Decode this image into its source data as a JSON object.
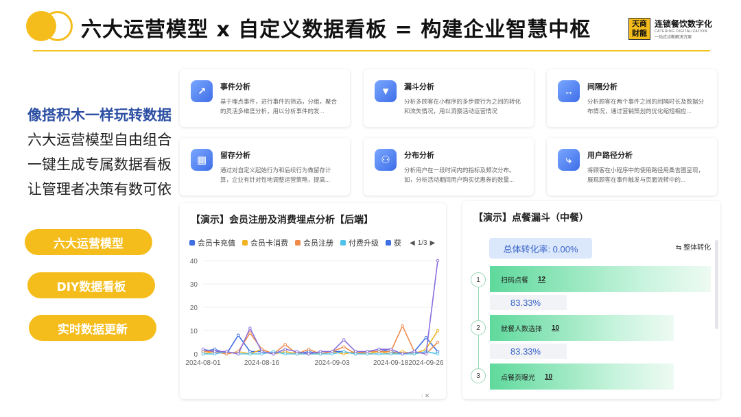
{
  "header": {
    "title": "六大运营模型 x 自定义数据看板 = 构建企业智慧中枢",
    "brand": {
      "seal_top": "天商",
      "seal_bottom": "财龍",
      "name": "连锁餐饮数字化",
      "sub": "CATERING DIGITALIZATION",
      "slogan": "一站式诊断解决方案"
    },
    "accent_color": "#f5bd1c"
  },
  "slogans": [
    "像搭积木一样玩转数据",
    "六大运营模型自由组合",
    "一键生成专属数据看板",
    "让管理者决策有数可依"
  ],
  "pills": [
    "六大运营模型",
    "DIY数据看板",
    "实时数据更新"
  ],
  "cards": [
    {
      "title": "事件分析",
      "icon": "chart-line-icon",
      "desc": "基于埋点事件，进行事件的筛选，分组，聚合的灵活多维度分析，用以分析事件的发..."
    },
    {
      "title": "漏斗分析",
      "icon": "funnel-icon",
      "desc": "分析多顾客在小程序的多步骤行为之间的转化和流失情况，用以洞察活动运营情况"
    },
    {
      "title": "间隔分析",
      "icon": "interval-icon",
      "desc": "分析顾客在两个事件之间的间隔时长及数据分布情况，通过营销策划的优化缩短相应..."
    },
    {
      "title": "留存分析",
      "icon": "table-icon",
      "desc": "通过对自定义起始行为和后续行为做留存计算，企业有针对性地调整运营策略，提高..."
    },
    {
      "title": "分布分析",
      "icon": "distribution-icon",
      "desc": "分析用户在一段时间内的指标及频次分布。如，分析活动期间用户购买优惠券的数量..."
    },
    {
      "title": "用户路径分析",
      "icon": "path-icon",
      "desc": "将顾客在小程序中的使用路径用桑吉图呈现，展现顾客在事件触发与页面流转中的..."
    }
  ],
  "left_panel": {
    "title": "【演示】会员注册及消费埋点分析【后端】",
    "legend_more": "获",
    "page": "1/3"
  },
  "chart_data": {
    "type": "line",
    "x": [
      "2024-08-01",
      "2024-08-04",
      "2024-08-07",
      "2024-08-10",
      "2024-08-13",
      "2024-08-16",
      "2024-08-19",
      "2024-08-22",
      "2024-08-25",
      "2024-08-28",
      "2024-08-31",
      "2024-09-03",
      "2024-09-06",
      "2024-09-09",
      "2024-09-12",
      "2024-09-15",
      "2024-09-18",
      "2024-09-21",
      "2024-09-24",
      "2024-09-27",
      "2024-09-30"
    ],
    "x_tick_labels": [
      "2024-08-01",
      "2024-08-16",
      "2024-09-03",
      "2024-09-18",
      "2024-09-26"
    ],
    "ylim": [
      0,
      40
    ],
    "y_ticks": [
      0,
      10,
      20,
      30,
      40
    ],
    "series": [
      {
        "name": "会员卡充值",
        "color": "#3f6fe0",
        "values": [
          1,
          2,
          0,
          8,
          1,
          1,
          0,
          1,
          0,
          1,
          0,
          1,
          1,
          0,
          1,
          2,
          1,
          0,
          1,
          7,
          1
        ]
      },
      {
        "name": "会员卡消费",
        "color": "#f0b323",
        "values": [
          0,
          1,
          0,
          1,
          0,
          2,
          0,
          1,
          0,
          0,
          0,
          1,
          0,
          1,
          0,
          1,
          0,
          1,
          0,
          2,
          10
        ]
      },
      {
        "name": "会员注册",
        "color": "#ef8a4d",
        "values": [
          1,
          1,
          0,
          1,
          9,
          2,
          0,
          4,
          0,
          2,
          0,
          1,
          3,
          0,
          1,
          1,
          1,
          12,
          1,
          0,
          5
        ]
      },
      {
        "name": "付费升级",
        "color": "#50c1e9",
        "values": [
          0,
          0,
          1,
          0,
          0,
          0,
          1,
          0,
          0,
          0,
          0,
          0,
          1,
          0,
          0,
          0,
          0,
          0,
          0,
          1,
          0
        ]
      },
      {
        "name": "获",
        "color": "#8a6fdc",
        "values": [
          2,
          1,
          1,
          0,
          11,
          1,
          0,
          2,
          1,
          0,
          1,
          1,
          6,
          1,
          1,
          2,
          2,
          0,
          1,
          0,
          40
        ]
      }
    ]
  },
  "right_panel": {
    "title": "【演示】点餐漏斗（中餐）",
    "overall_rate": "总体转化率: 0.00%",
    "overall_toggle": "整体转化",
    "steps": [
      {
        "num": "1",
        "name": "扫码点餐",
        "count": "12",
        "conv": "83.33%"
      },
      {
        "num": "2",
        "name": "就餐人数选择",
        "count": "10",
        "conv": "83.33%"
      },
      {
        "num": "3",
        "name": "点餐页曝光",
        "count": "10"
      }
    ]
  }
}
